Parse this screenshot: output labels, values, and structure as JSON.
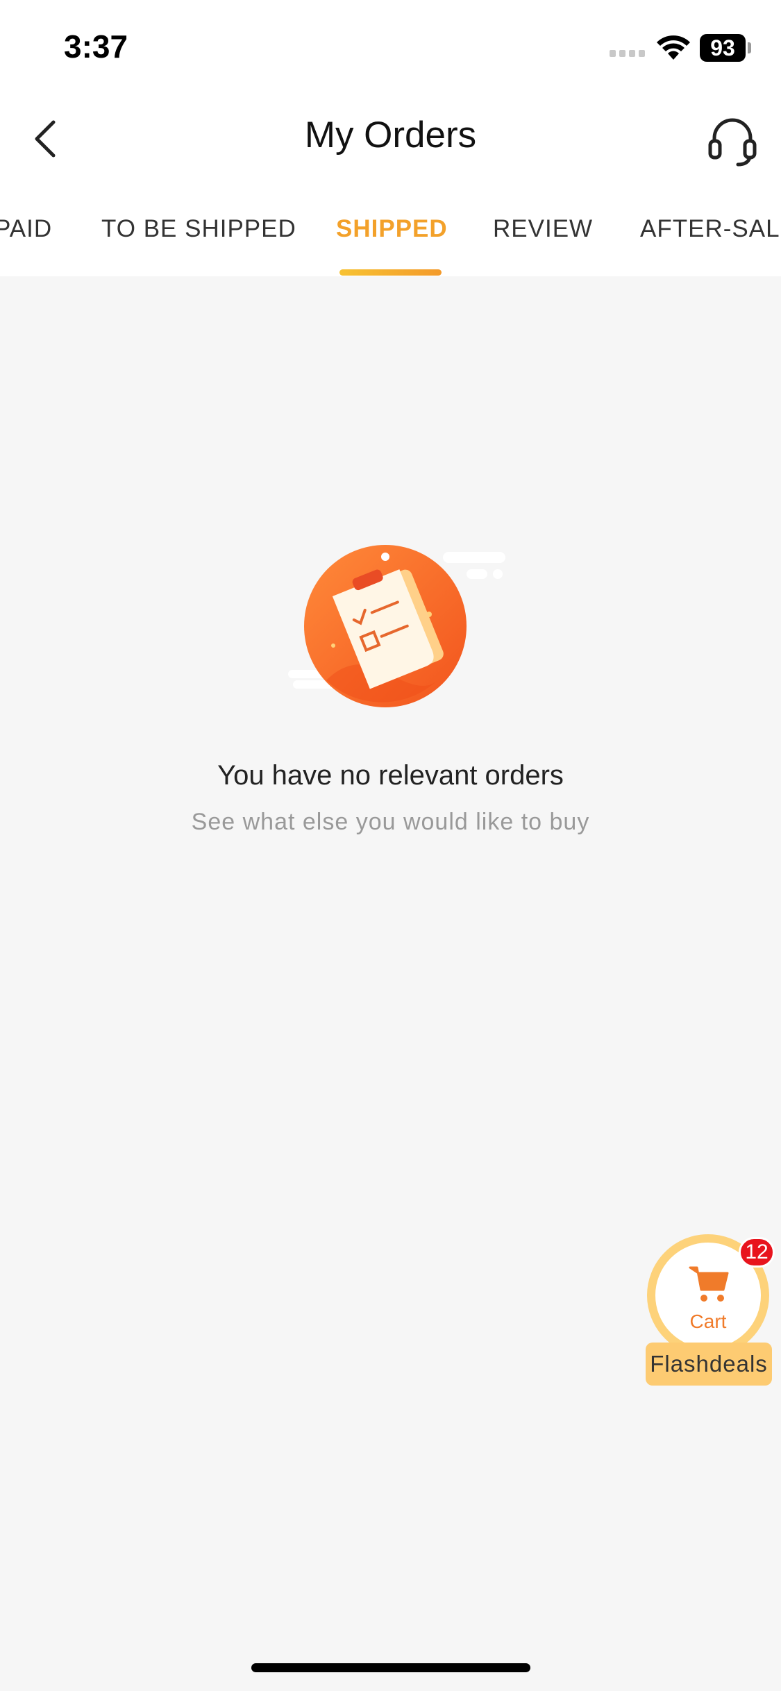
{
  "status_bar": {
    "time": "3:37",
    "battery": "93"
  },
  "header": {
    "title": "My Orders"
  },
  "tabs": [
    {
      "label": "PAID",
      "active": false
    },
    {
      "label": "TO BE SHIPPED",
      "active": false
    },
    {
      "label": "SHIPPED",
      "active": true
    },
    {
      "label": "REVIEW",
      "active": false
    },
    {
      "label": "AFTER-SALE",
      "active": false
    }
  ],
  "empty_state": {
    "title": "You have no relevant orders",
    "subtitle": "See what else you would like to buy"
  },
  "cart_float": {
    "label": "Cart",
    "badge_count": "12",
    "promo_label": "Flashdeals"
  },
  "colors": {
    "accent": "#f3a12a",
    "orange": "#f07b2a",
    "badge": "#e8141d",
    "background": "#f6f6f6"
  }
}
